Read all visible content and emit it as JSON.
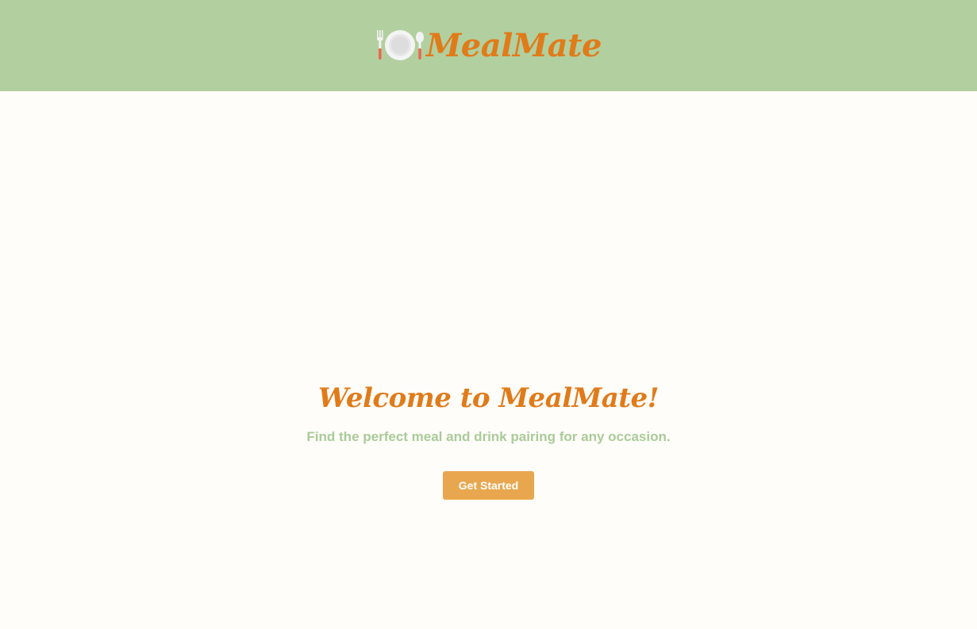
{
  "header": {
    "brand": "MealMate",
    "logo_icon": "plate-fork-spoon-icon"
  },
  "hero": {
    "title": "Welcome to MealMate!",
    "subtitle": "Find the perfect meal and drink pairing for any occasion.",
    "cta_label": "Get Started"
  },
  "colors": {
    "header_bg": "#b2cfa0",
    "brand_orange": "#e07b1a",
    "subtitle_green": "#a9cb98",
    "button_bg": "#e8a74e",
    "page_bg": "#fffdfa"
  }
}
